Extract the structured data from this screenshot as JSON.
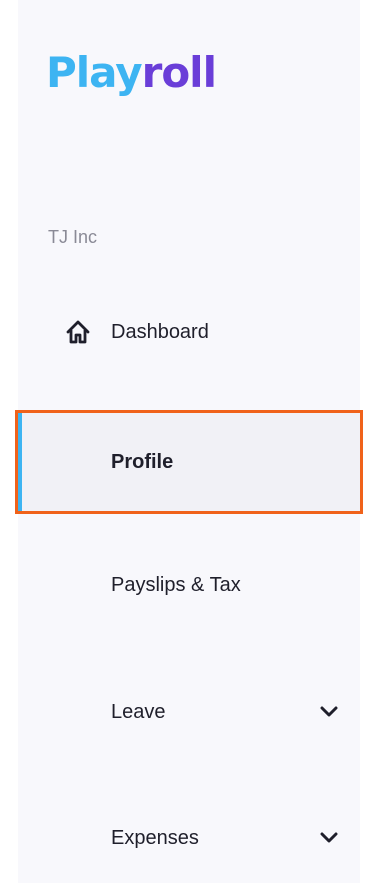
{
  "brand": {
    "logo_part1": "Play",
    "logo_part2": "roll",
    "colors": {
      "blue": "#3db4f2",
      "purple": "#6a3ed8"
    }
  },
  "org_name": "TJ Inc",
  "nav": {
    "dashboard": {
      "label": "Dashboard",
      "icon": "home-icon"
    },
    "profile": {
      "label": "Profile",
      "active": true
    },
    "payslips": {
      "label": "Payslips & Tax"
    },
    "leave": {
      "label": "Leave",
      "icon": "chevron-down-icon"
    },
    "expenses": {
      "label": "Expenses",
      "icon": "chevron-down-icon"
    }
  },
  "highlight_color": "#f0621a"
}
